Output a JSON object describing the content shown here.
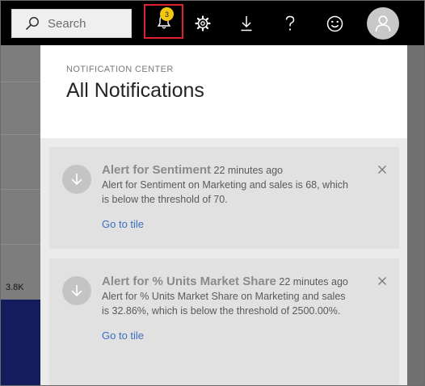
{
  "topbar": {
    "search_placeholder": "Search",
    "notification_count": "3",
    "icons": [
      "bell-icon",
      "gear-icon",
      "download-icon",
      "help-icon",
      "smiley-icon",
      "user-avatar-icon"
    ]
  },
  "background": {
    "value_label": "3.8K"
  },
  "panel": {
    "subheading": "NOTIFICATION CENTER",
    "title": "All Notifications",
    "notifications": [
      {
        "title": "Alert for Sentiment",
        "time": "22 minutes ago",
        "message": "Alert for Sentiment on Marketing and sales is 68, which is below the threshold of 70.",
        "link": "Go to tile"
      },
      {
        "title": "Alert for % Units Market Share",
        "time": "22 minutes ago",
        "message": "Alert for % Units Market Share on Marketing and sales is 32.86%, which is below the threshold of 2500.00%.",
        "link": "Go to tile"
      }
    ]
  },
  "colors": {
    "topbar": "#000000",
    "highlight": "#e0202f",
    "badge": "#f2c811",
    "link": "#3a6fbf",
    "card": "#e1e1e1"
  }
}
